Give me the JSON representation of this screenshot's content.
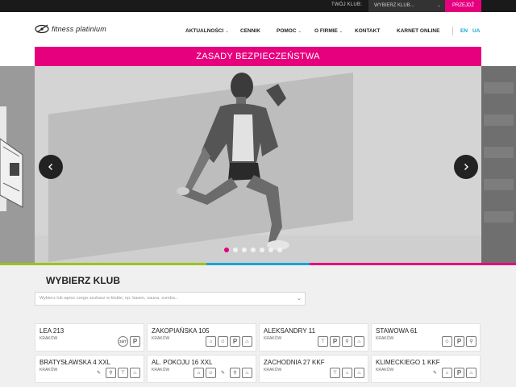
{
  "topbar": {
    "club_label": "TWÓJ KLUB:",
    "club_select": "WYBIERZ KLUB...",
    "go_button": "PRZEJDŹ"
  },
  "header": {
    "logo_text": "fitness platinium"
  },
  "nav": {
    "items": [
      "AKTUALNOŚCI",
      "CENNIK",
      "POMOC",
      "O FIRMIE",
      "KONTAKT",
      "KARNET ONLINE"
    ],
    "languages": [
      "EN",
      "UA"
    ]
  },
  "banner": {
    "title": "ZASADY BEZPIECZEŃSTWA"
  },
  "slider": {
    "dot_count": 7,
    "active_dot": 1
  },
  "colors": {
    "accent": "#e6007e",
    "link": "#1aa3d6",
    "stripe_green": "#9bc31c",
    "stripe_blue": "#1aa3d6",
    "stripe_pink": "#e6007e"
  },
  "clubs": {
    "title": "WYBIERZ KLUB",
    "search_placeholder": "Wybierz lub wpisz czego szukasz w klubie, np. basen, sauna, zumba...",
    "items": [
      {
        "name": "LEA 213",
        "city": "KRAKÓW",
        "icons": [
          "24-7-icon",
          "parking-icon"
        ]
      },
      {
        "name": "ZAKOPIAŃSKA 105",
        "city": "KRAKÓW",
        "icons": [
          "kids-room-icon",
          "kids-icon",
          "parking-icon",
          "sauna-icon"
        ]
      },
      {
        "name": "ALEKSANDRY 11",
        "city": "KRAKÓW",
        "icons": [
          "gym-icon",
          "parking-icon",
          "cycling-icon",
          "sauna-icon"
        ]
      },
      {
        "name": "STAWOWA 61",
        "city": "KRAKÓW",
        "icons": [
          "kids-icon",
          "parking-icon",
          "cycling-icon"
        ]
      },
      {
        "name": "BRATYSŁAWSKA 4 XXL",
        "city": "KRAKÓW",
        "icons": [
          "massage-icon",
          "cycling-icon",
          "gym-icon",
          "sauna-icon"
        ]
      },
      {
        "name": "AL. POKOJU 16 XXL",
        "city": "KRAKÓW",
        "icons": [
          "kids-room-icon",
          "kids-icon",
          "massage-icon",
          "cycling-icon",
          "sauna-icon"
        ]
      },
      {
        "name": "ZACHODNIA 27 KKF",
        "city": "KRAKÓW",
        "icons": [
          "gym-icon",
          "kids-room-icon",
          "sauna-icon"
        ]
      },
      {
        "name": "KLIMECKIEGO 1 KKF",
        "city": "KRAKÓW",
        "icons": [
          "massage-icon",
          "kids-room-icon",
          "parking-icon",
          "sauna-icon"
        ]
      }
    ]
  }
}
